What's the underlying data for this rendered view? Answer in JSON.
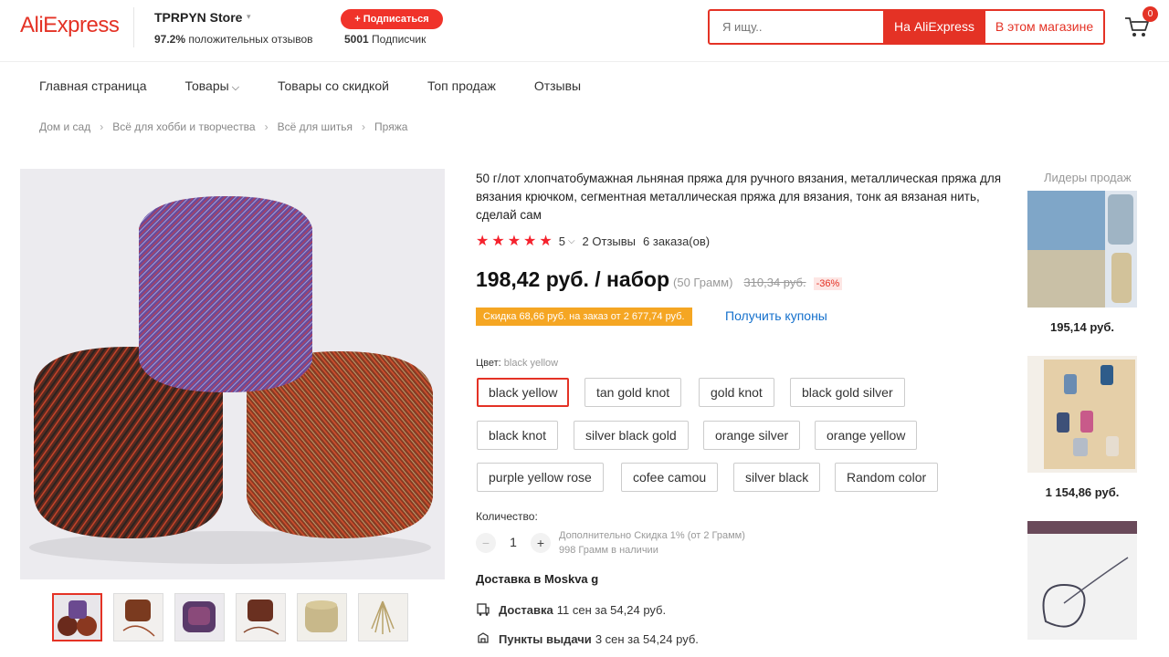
{
  "header": {
    "logo": "AliExpress",
    "store_name": "TPRPYN Store",
    "rating_pct": "97.2%",
    "rating_text": "положительных отзывов",
    "subscribe_label": "+ Подписаться",
    "followers_count": "5001",
    "followers_text": "Подписчик",
    "search_placeholder": "Я ищу..",
    "search_btn_site": "На AliExpress",
    "search_btn_store": "В этом магазине",
    "cart_count": "0"
  },
  "nav": {
    "items": [
      "Главная страница",
      "Товары",
      "Товары со скидкой",
      "Топ продаж",
      "Отзывы"
    ]
  },
  "breadcrumb": [
    "Дом и сад",
    "Всё для хобби и творчества",
    "Всё для шитья",
    "Пряжа"
  ],
  "product": {
    "title": "50 г/лот хлопчатобумажная льняная пряжа для ручного вязания, металлическая пряжа для вязания крючком, сегментная металлическая пряжа для вязания, тонк ая вязаная нить, сделай сам",
    "rating": "5",
    "reviews": "2 Отзывы",
    "orders": "6 заказа(ов)",
    "price": "198,42 руб. / набор",
    "unit_note": "(50 Грамм)",
    "old_price": "310,34 руб.",
    "discount": "-36%",
    "coupon_text": "Скидка 68,66 руб. на заказ от 2 677,74 руб.",
    "coupon_link": "Получить купоны",
    "color_label": "Цвет:",
    "color_value": "black yellow",
    "colors": [
      "black yellow",
      "tan gold knot",
      "gold knot",
      "black gold silver",
      "black knot",
      "silver black gold",
      "orange silver",
      "orange yellow",
      "purple yellow rose",
      "cofee camou",
      "silver black",
      "Random color"
    ],
    "quantity_label": "Количество:",
    "quantity": "1",
    "qty_minus": "−",
    "qty_plus": "+",
    "qty_note1": "Дополнительно Скидка 1% (от 2 Грамм)",
    "qty_note2": "998 Грамм в наличии",
    "delivery_heading": "Доставка в Moskva g",
    "shipping": [
      {
        "label": "Доставка",
        "text": "11 сен за 54,24 руб.",
        "icon": "truck-icon"
      },
      {
        "label": "Пункты выдачи",
        "text": "3 сен за 54,24 руб.",
        "icon": "pickup-icon"
      }
    ]
  },
  "bestsellers": {
    "title": "Лидеры продаж",
    "items": [
      {
        "price": "195,14 руб."
      },
      {
        "price": "1 154,86 руб."
      }
    ]
  },
  "colors": {
    "accent": "#e43225",
    "coupon": "#f5a623",
    "link": "#1470cc"
  }
}
